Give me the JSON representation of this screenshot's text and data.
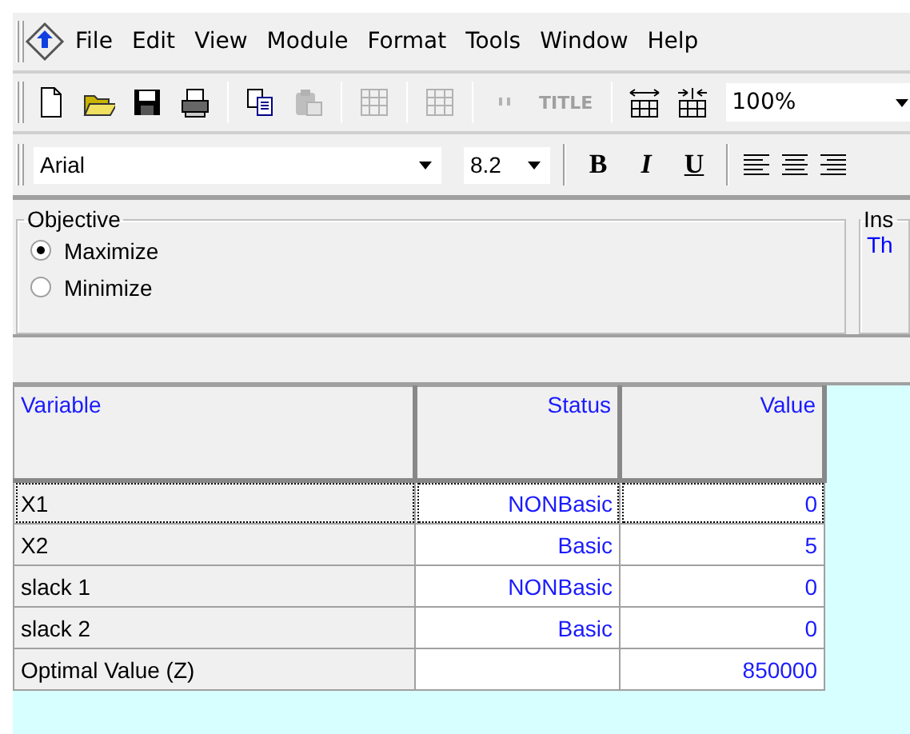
{
  "menu": [
    {
      "label": "File"
    },
    {
      "label": "Edit"
    },
    {
      "label": "View"
    },
    {
      "label": "Module"
    },
    {
      "label": "Format"
    },
    {
      "label": "Tools"
    },
    {
      "label": "Window"
    },
    {
      "label": "Help"
    }
  ],
  "toolbar": {
    "items": [
      {
        "kind": "new",
        "disabled": false
      },
      {
        "kind": "open",
        "disabled": false
      },
      {
        "kind": "save",
        "disabled": false
      },
      {
        "kind": "print",
        "disabled": false
      },
      {
        "kind": "sep"
      },
      {
        "kind": "copy",
        "disabled": false
      },
      {
        "kind": "paste",
        "disabled": true
      },
      {
        "kind": "sep"
      },
      {
        "kind": "grid",
        "disabled": true
      },
      {
        "kind": "sep"
      },
      {
        "kind": "grid",
        "disabled": true
      },
      {
        "kind": "sep"
      },
      {
        "kind": "quote",
        "disabled": true
      },
      {
        "kind": "text",
        "label": "TITLE",
        "disabled": true
      },
      {
        "kind": "sep"
      },
      {
        "kind": "widen",
        "disabled": false
      },
      {
        "kind": "narrow",
        "disabled": false
      }
    ],
    "zoom": "100%"
  },
  "format_bar": {
    "font": "Arial",
    "size": "8.2",
    "buttons": [
      {
        "label": "B",
        "kind": "bold"
      },
      {
        "label": "I",
        "kind": "italic"
      },
      {
        "label": "U",
        "kind": "underline"
      }
    ]
  },
  "objective": {
    "title": "Objective",
    "options": [
      {
        "label": "Maximize",
        "selected": true
      },
      {
        "label": "Minimize",
        "selected": false
      }
    ]
  },
  "instructions": {
    "title": "Ins",
    "text": "Th"
  },
  "table": {
    "columns": [
      "Variable",
      "Status",
      "Value"
    ],
    "rows": [
      {
        "cells": [
          "X1",
          "NONBasic",
          "0"
        ],
        "selected": true
      },
      {
        "cells": [
          "X2",
          "Basic",
          "5"
        ],
        "selected": false
      },
      {
        "cells": [
          "slack 1",
          "NONBasic",
          "0"
        ],
        "selected": false
      },
      {
        "cells": [
          "slack 2",
          "Basic",
          "0"
        ],
        "selected": false
      },
      {
        "cells": [
          "Optimal Value (Z)",
          "",
          "850000"
        ],
        "selected": false
      }
    ]
  }
}
